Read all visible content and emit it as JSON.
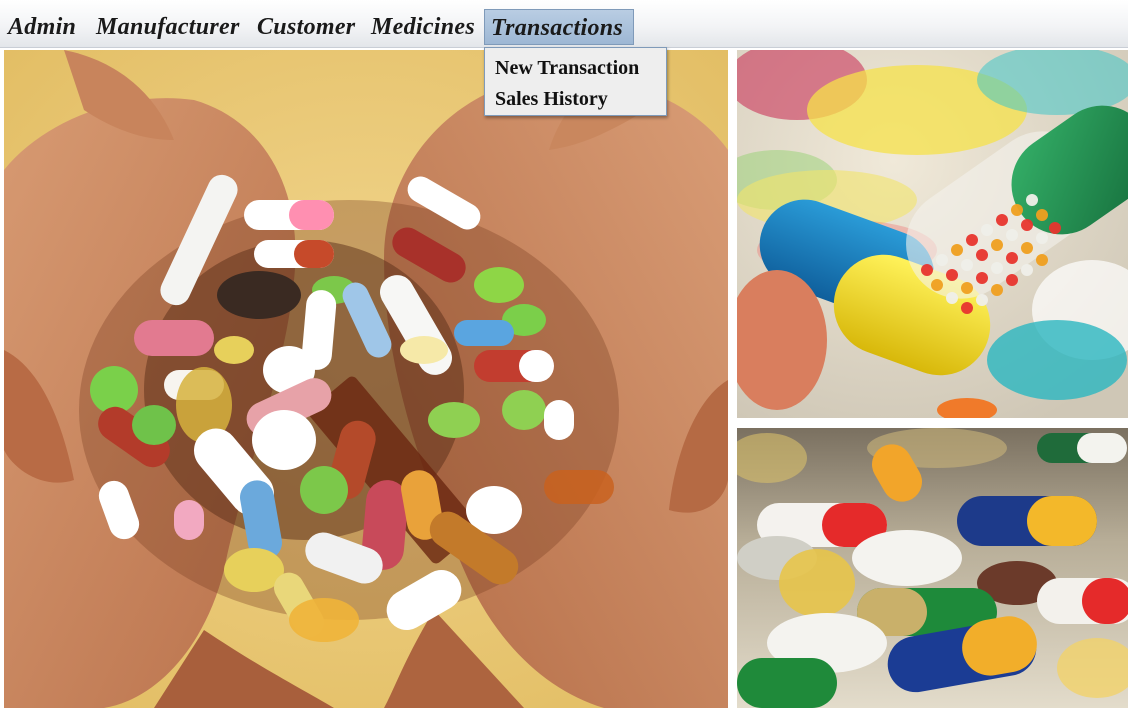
{
  "menubar": {
    "items": [
      {
        "label": "Admin"
      },
      {
        "label": "Manufacturer"
      },
      {
        "label": "Customer"
      },
      {
        "label": "Medicines"
      },
      {
        "label": "Transactions",
        "active": true
      }
    ]
  },
  "dropdown": {
    "items": [
      {
        "label": "New Transaction"
      },
      {
        "label": "Sales History"
      }
    ]
  },
  "images": [
    {
      "name": "hands-holding-pills-photo"
    },
    {
      "name": "capsule-closeup-photo"
    },
    {
      "name": "assorted-pills-photo"
    }
  ],
  "colors": {
    "menu_active_bg": "#a9c1db",
    "dropdown_bg": "#eeeeee"
  }
}
